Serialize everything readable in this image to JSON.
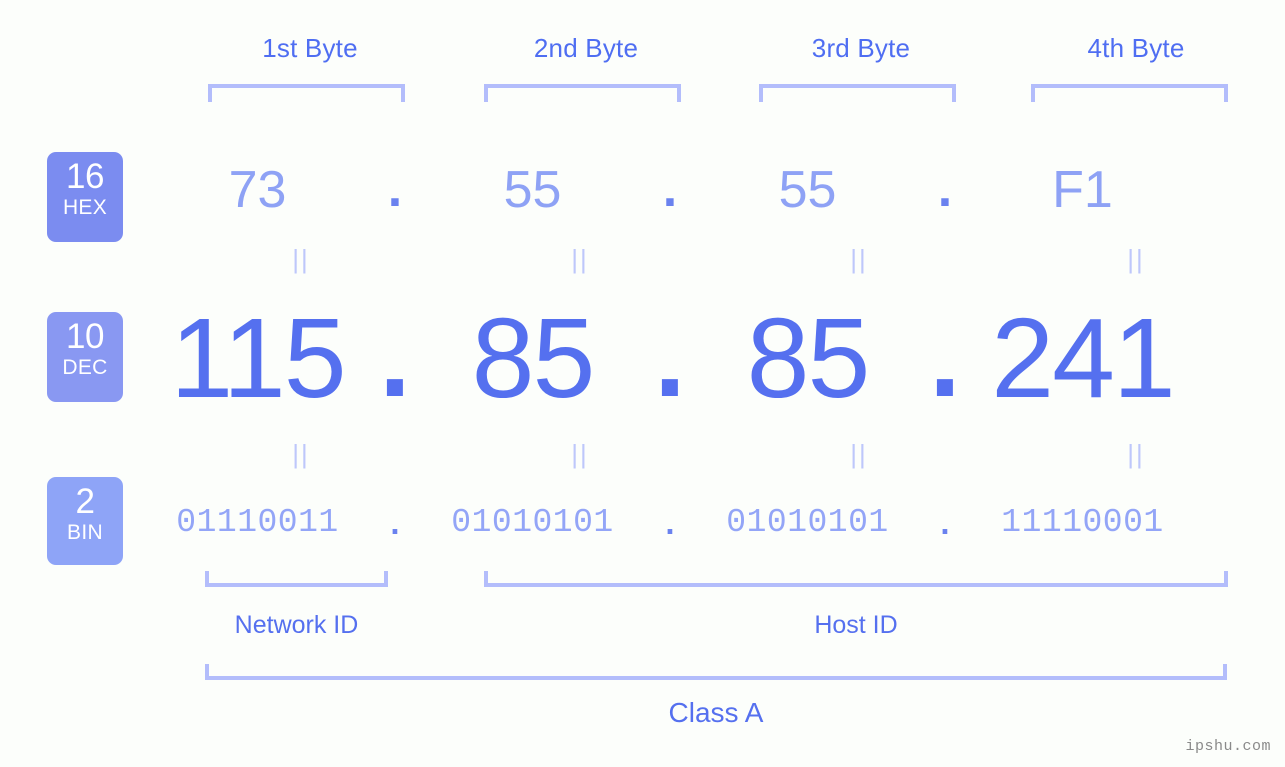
{
  "background_color": "#fcfefb",
  "accent_color": "#5570ef",
  "muted_accent_color": "#8ea2f5",
  "bracket_color": "#b3bdfb",
  "headers": {
    "byte1": "1st Byte",
    "byte2": "2nd Byte",
    "byte3": "3rd Byte",
    "byte4": "4th Byte"
  },
  "bases": [
    {
      "number": "16",
      "abbr": "HEX",
      "color": "#7b8cf0"
    },
    {
      "number": "10",
      "abbr": "DEC",
      "color": "#8998f2"
    },
    {
      "number": "2",
      "abbr": "BIN",
      "color": "#8ea4f7"
    }
  ],
  "separator": ".",
  "equals_glyph": "||",
  "rows": {
    "hex": {
      "label": "HEX",
      "octets": [
        "73",
        "55",
        "55",
        "F1"
      ]
    },
    "dec": {
      "label": "DEC",
      "octets": [
        "115",
        "85",
        "85",
        "241"
      ]
    },
    "bin": {
      "label": "BIN",
      "octets": [
        "01110011",
        "01010101",
        "01010101",
        "11110001"
      ]
    }
  },
  "segments": {
    "network_id": "Network ID",
    "host_id": "Host ID",
    "class": "Class A"
  },
  "watermark": "ipshu.com"
}
